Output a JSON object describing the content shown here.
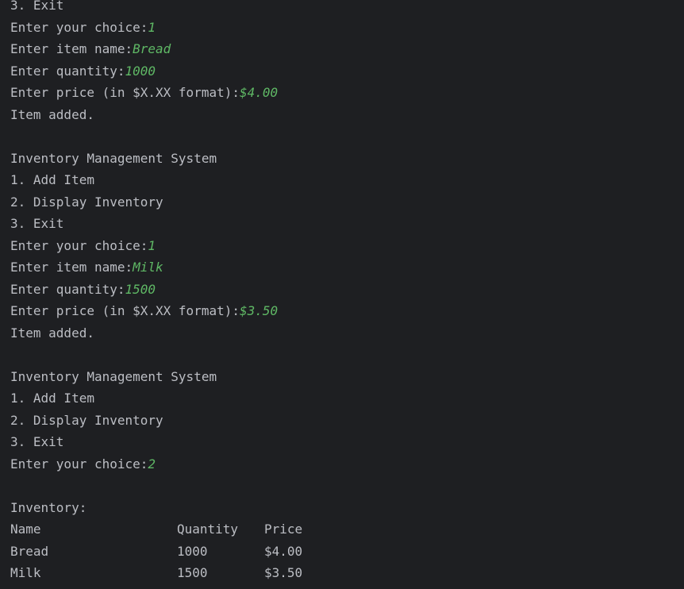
{
  "console": {
    "block1": {
      "exit_item": "3. Exit",
      "choice_prompt": "Enter your choice:",
      "choice_value": "1",
      "name_prompt": "Enter item name:",
      "name_value": "Bread",
      "qty_prompt": "Enter quantity:",
      "qty_value": "1000",
      "price_prompt": "Enter price (in $X.XX format):",
      "price_value": "$4.00",
      "result": "Item added."
    },
    "block2": {
      "menu_title": "Inventory Management System",
      "menu_1": "1. Add Item",
      "menu_2": "2. Display Inventory",
      "menu_3": "3. Exit",
      "choice_prompt": "Enter your choice:",
      "choice_value": "1",
      "name_prompt": "Enter item name:",
      "name_value": "Milk",
      "qty_prompt": "Enter quantity:",
      "qty_value": "1500",
      "price_prompt": "Enter price (in $X.XX format):",
      "price_value": "$3.50",
      "result": "Item added."
    },
    "block3": {
      "menu_title": "Inventory Management System",
      "menu_1": "1. Add Item",
      "menu_2": "2. Display Inventory",
      "menu_3": "3. Exit",
      "choice_prompt": "Enter your choice:",
      "choice_value": "2"
    },
    "inventory": {
      "title": "Inventory:",
      "headers": [
        "Name",
        "Quantity",
        "Price"
      ],
      "rows": [
        [
          "Bread",
          "1000",
          "$4.00"
        ],
        [
          "Milk",
          "1500",
          "$3.50"
        ]
      ]
    }
  },
  "colors": {
    "background": "#1e1f22",
    "output_text": "#bcbec4",
    "user_input": "#5fb865"
  }
}
